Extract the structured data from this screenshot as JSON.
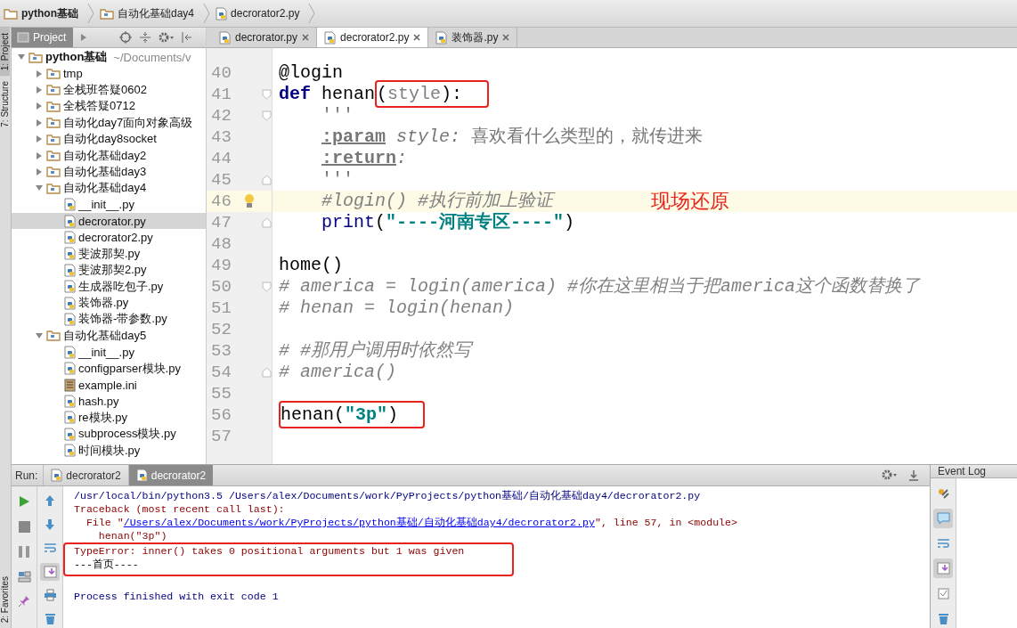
{
  "breadcrumbs": [
    {
      "label": "python基础"
    },
    {
      "label": "自动化基础day4"
    },
    {
      "label": "decrorator2.py"
    }
  ],
  "side_tabs": [
    {
      "label": "1: Project",
      "selected": true
    },
    {
      "label": "7: Structure",
      "selected": false
    },
    {
      "label": "2: Favorites",
      "selected": false
    }
  ],
  "project_tool": {
    "label": "Project"
  },
  "editor_tabs": [
    {
      "label": "decrorator.py",
      "selected": false
    },
    {
      "label": "decrorator2.py",
      "selected": true
    },
    {
      "label": "装饰器.py",
      "selected": false
    }
  ],
  "tree": {
    "label": "python基础",
    "path": "~/Documents/v",
    "kind": "folder",
    "expanded": true,
    "selected": false,
    "children": [
      {
        "label": "tmp",
        "kind": "folder",
        "expanded": false,
        "selected": false
      },
      {
        "label": "全栈班答疑0602",
        "kind": "folder",
        "expanded": false,
        "selected": false
      },
      {
        "label": "全栈答疑0712",
        "kind": "folder",
        "expanded": false,
        "selected": false
      },
      {
        "label": "自动化day7面向对象高级",
        "kind": "folder",
        "expanded": false,
        "selected": false
      },
      {
        "label": "自动化day8socket",
        "kind": "folder",
        "expanded": false,
        "selected": false
      },
      {
        "label": "自动化基础day2",
        "kind": "folder",
        "expanded": false,
        "selected": false
      },
      {
        "label": "自动化基础day3",
        "kind": "folder",
        "expanded": false,
        "selected": false
      },
      {
        "label": "自动化基础day4",
        "kind": "folder",
        "expanded": true,
        "selected": false,
        "children": [
          {
            "label": "__init__.py",
            "kind": "python",
            "selected": false
          },
          {
            "label": "decrorator.py",
            "kind": "python",
            "selected": true
          },
          {
            "label": "decrorator2.py",
            "kind": "python",
            "selected": false
          },
          {
            "label": "斐波那契.py",
            "kind": "python",
            "selected": false
          },
          {
            "label": "斐波那契2.py",
            "kind": "python",
            "selected": false
          },
          {
            "label": "生成器吃包子.py",
            "kind": "python",
            "selected": false
          },
          {
            "label": "装饰器.py",
            "kind": "python",
            "selected": false
          },
          {
            "label": "装饰器-带参数.py",
            "kind": "python",
            "selected": false
          }
        ]
      },
      {
        "label": "自动化基础day5",
        "kind": "folder",
        "expanded": true,
        "selected": false,
        "children": [
          {
            "label": "__init__.py",
            "kind": "python",
            "selected": false
          },
          {
            "label": "configparser模块.py",
            "kind": "python",
            "selected": false
          },
          {
            "label": "example.ini",
            "kind": "ini",
            "selected": false
          },
          {
            "label": "hash.py",
            "kind": "python",
            "selected": false
          },
          {
            "label": "re模块.py",
            "kind": "python",
            "selected": false
          },
          {
            "label": "subprocess模块.py",
            "kind": "python",
            "selected": false
          },
          {
            "label": "时间模块.py",
            "kind": "python",
            "selected": false
          }
        ]
      }
    ]
  },
  "editor": {
    "lines": [
      {
        "number": "40",
        "current": false,
        "indented": false,
        "tokens": [
          {
            "text": "@login",
            "kind": "deco"
          }
        ]
      },
      {
        "number": "41",
        "current": false,
        "indented": false,
        "fold_open": true,
        "tokens": [
          {
            "text": "def",
            "kind": "kw"
          },
          {
            "text": " henan",
            "kind": "plain"
          },
          {
            "text": "(",
            "kind": "plain",
            "boxed": true
          },
          {
            "text": "style",
            "kind": "param",
            "boxed": true
          },
          {
            "text": "):",
            "kind": "plain",
            "boxed": true
          }
        ]
      },
      {
        "number": "42",
        "current": false,
        "indented": true,
        "fold_open": true,
        "tokens": [
          {
            "text": "'''",
            "kind": "doc"
          }
        ]
      },
      {
        "number": "43",
        "current": false,
        "indented": true,
        "tokens": [
          {
            "text": ":param",
            "kind": "doctag"
          },
          {
            "text": " style:",
            "kind": "docitalic"
          },
          {
            "text": " 喜欢看什么类型的，就传进来",
            "kind": "doc"
          }
        ]
      },
      {
        "number": "44",
        "current": false,
        "indented": true,
        "tokens": [
          {
            "text": ":return",
            "kind": "doctag"
          },
          {
            "text": ":",
            "kind": "docitalic"
          }
        ]
      },
      {
        "number": "45",
        "current": false,
        "indented": true,
        "fold_close": true,
        "tokens": [
          {
            "text": "'''",
            "kind": "doc"
          }
        ]
      },
      {
        "number": "46",
        "current": true,
        "indented": true,
        "bulb": true,
        "note": "现场还原",
        "tokens": [
          {
            "text": "#login() #执行前加上验证",
            "kind": "comment"
          }
        ]
      },
      {
        "number": "47",
        "current": false,
        "indented": true,
        "fold_close": true,
        "tokens": [
          {
            "text": "print",
            "kind": "fn"
          },
          {
            "text": "(",
            "kind": "plain"
          },
          {
            "text": "\"----河南专区----\"",
            "kind": "str"
          },
          {
            "text": ")",
            "kind": "plain"
          }
        ]
      },
      {
        "number": "48",
        "current": false,
        "indented": false
      },
      {
        "number": "49",
        "current": false,
        "indented": false,
        "tokens": [
          {
            "text": "home()",
            "kind": "plain"
          }
        ]
      },
      {
        "number": "50",
        "current": false,
        "indented": false,
        "fold_open": true,
        "tokens": [
          {
            "text": "# america = login(america) #你在这里相当于把america这个函数替换了",
            "kind": "comment"
          }
        ]
      },
      {
        "number": "51",
        "current": false,
        "indented": false,
        "tokens": [
          {
            "text": "# henan = login(henan)",
            "kind": "comment"
          }
        ]
      },
      {
        "number": "52",
        "current": false,
        "indented": false
      },
      {
        "number": "53",
        "current": false,
        "indented": false,
        "tokens": [
          {
            "text": "# #那用户调用时依然写",
            "kind": "comment"
          }
        ]
      },
      {
        "number": "54",
        "current": false,
        "indented": false,
        "fold_close": true,
        "tokens": [
          {
            "text": "# america()",
            "kind": "comment"
          }
        ]
      },
      {
        "number": "55",
        "current": false,
        "indented": false
      },
      {
        "number": "56",
        "current": false,
        "indented": false,
        "tokens": [
          {
            "text": "henan(",
            "kind": "plain",
            "boxed": true
          },
          {
            "text": "\"3p\"",
            "kind": "str",
            "boxed": true
          },
          {
            "text": ")",
            "kind": "plain",
            "boxed": true
          }
        ]
      },
      {
        "number": "57",
        "current": false,
        "indented": false
      }
    ]
  },
  "run": {
    "title": "Run:",
    "tabs": [
      {
        "label": "decrorator2",
        "selected": false
      },
      {
        "label": "decrorator2",
        "selected": true
      }
    ],
    "console": [
      {
        "boxed": false,
        "segments": [
          {
            "text": "/usr/local/bin/python3.5 /Users/alex/Documents/work/PyProjects/python基础/自动化基础day4/decrorator2.py",
            "kind": "cmd"
          }
        ]
      },
      {
        "boxed": false,
        "segments": [
          {
            "text": "Traceback (most recent call last):",
            "kind": "err"
          }
        ]
      },
      {
        "boxed": false,
        "segments": [
          {
            "text": "  File \"",
            "kind": "err"
          },
          {
            "text": "/Users/alex/Documents/work/PyProjects/python基础/自动化基础day4/decrorator2.py",
            "kind": "link"
          },
          {
            "text": "\", line 57, in <module>",
            "kind": "err"
          }
        ]
      },
      {
        "boxed": false,
        "segments": [
          {
            "text": "    henan(\"3p\")",
            "kind": "err"
          }
        ]
      },
      {
        "boxed": true,
        "segments": [
          {
            "text": "TypeError: inner() takes 0 positional arguments but 1 was given",
            "kind": "err"
          }
        ]
      },
      {
        "boxed": true,
        "segments": [
          {
            "text": "---首页----",
            "kind": "out"
          }
        ]
      },
      {
        "boxed": false,
        "space_before": true,
        "segments": [
          {
            "text": "Process finished with exit code 1",
            "kind": "cmd"
          }
        ]
      }
    ]
  },
  "event_log": {
    "title": "Event Log"
  }
}
